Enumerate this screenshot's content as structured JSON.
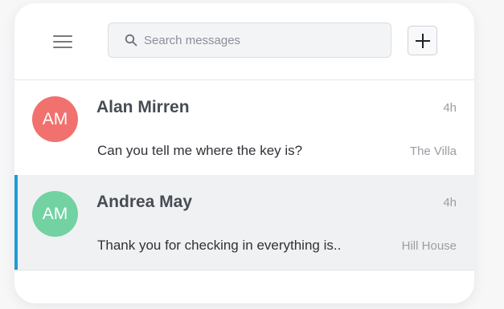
{
  "header": {
    "menu_icon": "hamburger-menu-icon",
    "search": {
      "placeholder": "Search messages",
      "value": "",
      "icon": "search-icon"
    },
    "add_icon": "plus-icon"
  },
  "conversations": [
    {
      "initials": "AM",
      "avatar_color": "#f0716e",
      "name": "Alan Mirren",
      "time": "4h",
      "preview": "Can you tell me where the key is?",
      "location": "The Villa",
      "selected": false
    },
    {
      "initials": "AM",
      "avatar_color": "#72d2a1",
      "name": "Andrea May",
      "time": "4h",
      "preview": "Thank you for checking in everything is..",
      "location": "Hill House",
      "selected": true
    }
  ],
  "colors": {
    "selected_accent": "#1d9bd6",
    "selected_background": "#f0f1f3"
  }
}
